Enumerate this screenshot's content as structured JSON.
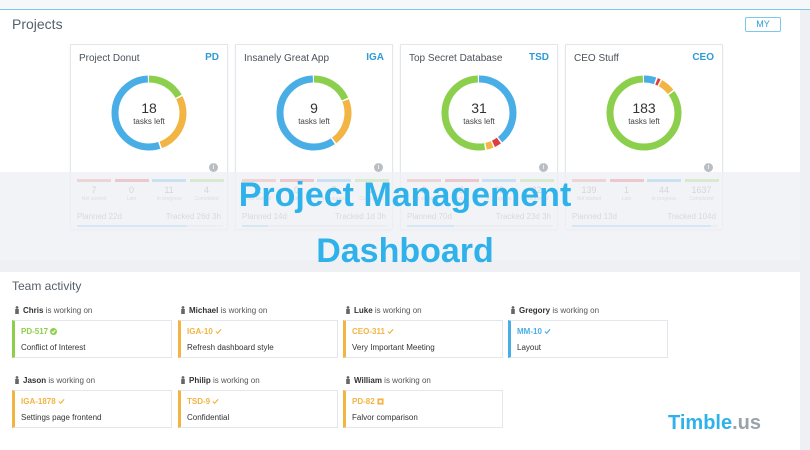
{
  "header": {
    "title": "Projects",
    "filter_label": "MY"
  },
  "projects": [
    {
      "name": "Project Donut",
      "code": "PD",
      "tasks_left": "18",
      "tasks_left_label": "tasks left",
      "stats": [
        {
          "label": "Not started",
          "value": "7",
          "color": "#e8786a"
        },
        {
          "label": "Late",
          "value": "0",
          "color": "#e03c3c"
        },
        {
          "label": "In progress",
          "value": "11",
          "color": "#4aaee6"
        },
        {
          "label": "Completed",
          "value": "4",
          "color": "#8ccf4d"
        }
      ],
      "planned": "Planned 22d",
      "tracked": "Tracked 26d 3h",
      "progress": 0.75,
      "donut": [
        {
          "value": 7,
          "color": "#8ccf4d"
        },
        {
          "value": 11,
          "color": "#f2b443"
        },
        {
          "value": 22,
          "color": "#4aaee6"
        }
      ]
    },
    {
      "name": "Insanely Great App",
      "code": "IGA",
      "tasks_left": "9",
      "tasks_left_label": "tasks left",
      "stats": [
        {
          "label": "Not started",
          "value": "2",
          "color": "#e8786a"
        },
        {
          "label": "Late",
          "value": "0",
          "color": "#e03c3c"
        },
        {
          "label": "In progress",
          "value": "7",
          "color": "#4aaee6"
        },
        {
          "label": "Completed",
          "value": "2",
          "color": "#8ccf4d"
        }
      ],
      "planned": "Planned 14d",
      "tracked": "Tracked 1d 3h",
      "progress": 0.18,
      "donut": [
        {
          "value": 7,
          "color": "#8ccf4d"
        },
        {
          "value": 8,
          "color": "#f2b443"
        },
        {
          "value": 22,
          "color": "#4aaee6"
        }
      ]
    },
    {
      "name": "Top Secret Database",
      "code": "TSD",
      "tasks_left": "31",
      "tasks_left_label": "tasks left",
      "stats": [
        {
          "label": "Not started",
          "value": "2",
          "color": "#e8786a"
        },
        {
          "label": "Late",
          "value": "3",
          "color": "#e03c3c"
        },
        {
          "label": "In progress",
          "value": "29",
          "color": "#4aaee6"
        },
        {
          "label": "Completed",
          "value": "22",
          "color": "#8ccf4d"
        }
      ],
      "planned": "Planned 70d",
      "tracked": "Tracked 23d 3h",
      "progress": 0.32,
      "donut": [
        {
          "value": 22,
          "color": "#4aaee6"
        },
        {
          "value": 2,
          "color": "#e03c3c"
        },
        {
          "value": 2,
          "color": "#f2b443"
        },
        {
          "value": 29,
          "color": "#8ccf4d"
        }
      ]
    },
    {
      "name": "CEO Stuff",
      "code": "CEO",
      "tasks_left": "183",
      "tasks_left_label": "tasks left",
      "stats": [
        {
          "label": "Not started",
          "value": "139",
          "color": "#e8786a"
        },
        {
          "label": "Late",
          "value": "1",
          "color": "#e03c3c"
        },
        {
          "label": "In progress",
          "value": "44",
          "color": "#4aaee6"
        },
        {
          "label": "Completed",
          "value": "1637",
          "color": "#8ccf4d"
        }
      ],
      "planned": "Planned 13d",
      "tracked": "Tracked 104d",
      "progress": 0.95,
      "donut": [
        {
          "value": 6,
          "color": "#4aaee6"
        },
        {
          "value": 2,
          "color": "#e03c3c"
        },
        {
          "value": 7,
          "color": "#f2b443"
        },
        {
          "value": 85,
          "color": "#8ccf4d"
        }
      ]
    }
  ],
  "headline": {
    "line1": "Project Management",
    "line2": "Dashboard"
  },
  "team": {
    "title": "Team activity",
    "working_on_text": "is working on",
    "members": [
      {
        "name": "Chris",
        "code": "PD-517",
        "status_icon": "check-circle-icon",
        "task": "Conflict of Interest",
        "color": "#8ccf4d"
      },
      {
        "name": "Michael",
        "code": "IGA-10",
        "status_icon": "check-icon",
        "task": "Refresh dashboard style",
        "color": "#f2b443"
      },
      {
        "name": "Luke",
        "code": "CEO-311",
        "status_icon": "check-icon",
        "task": "Very Important Meeting",
        "color": "#f2b443"
      },
      {
        "name": "Gregory",
        "code": "MM-10",
        "status_icon": "check-icon",
        "task": "Layout",
        "color": "#4aaee6"
      },
      {
        "name": "Jason",
        "code": "IGA-1878",
        "status_icon": "check-icon",
        "task": "Settings page frontend",
        "color": "#f2b443"
      },
      {
        "name": "Philip",
        "code": "TSD-9",
        "status_icon": "check-icon",
        "task": "Confidential",
        "color": "#f2b443"
      },
      {
        "name": "William",
        "code": "PD-82",
        "status_icon": "square-icon",
        "task": "Falvor comparison",
        "color": "#f2b443"
      }
    ]
  },
  "brand": {
    "name": "Timble",
    "suffix": ".us"
  },
  "colors": {
    "accent": "#2fb2ea",
    "panel_border": "#7cc7ee"
  }
}
